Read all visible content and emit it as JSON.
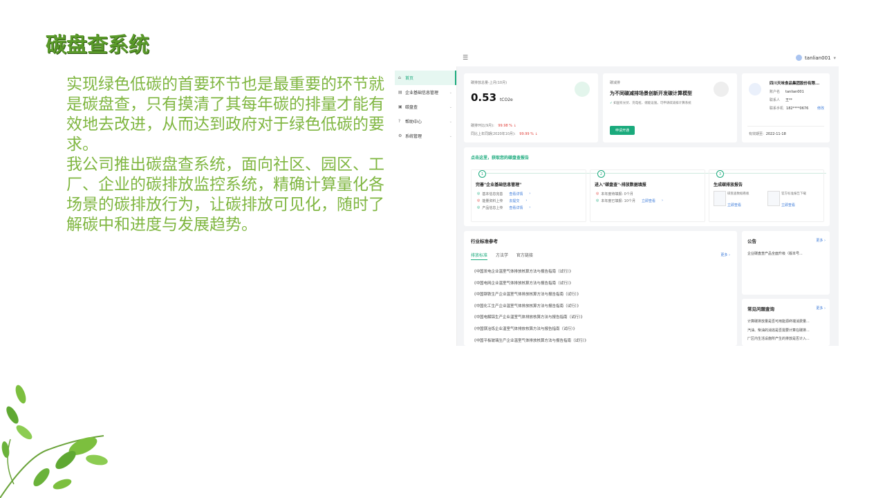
{
  "slide": {
    "title": "碳盘查系统",
    "paragraph1": "实现绿色低碳的首要环节也是最重要的环节就是碳盘查，只有摸清了其每年碳的排量才能有效地去改进，从而达到政府对于绿色低碳的要求。",
    "paragraph2": "我公司推出碳盘查系统，面向社区、园区、工厂、企业的碳排放监控系统，精确计算量化各场景的碳排放行为，让碳排放可见化，随时了解碳中和进度与发展趋势。"
  },
  "app": {
    "user": "tanlian001",
    "sidebar": [
      {
        "label": "首页",
        "icon": "home-icon"
      },
      {
        "label": "企业基础信息管理",
        "icon": "building-icon"
      },
      {
        "label": "碳盘查",
        "icon": "doc-icon"
      },
      {
        "label": "帮助中心",
        "icon": "help-icon"
      },
      {
        "label": "系统管理",
        "icon": "settings-icon"
      }
    ],
    "emission": {
      "label": "碳排放总量-上月(10月)",
      "value": "0.53",
      "unit": "tCO2e",
      "mom_label": "碳排环比(9月):",
      "mom_value": "99.98 %",
      "yoy_label": "同比上年同期(2020年10月):",
      "yoy_value": "99.99 %"
    },
    "reduction": {
      "label": "碳减排",
      "title": "为不同碳减排场景创新开发碳计算模型",
      "desc": "如固有光伏、充电桩、储能设施。可申请碳减排计算系统",
      "button": "申请开通"
    },
    "company": {
      "name": "四川天味食品集团股份有限...",
      "account_label": "账户名",
      "account": "tanlian001",
      "contact_label": "联系人",
      "contact": "王**",
      "phone_label": "联系手机",
      "phone": "182****0676",
      "edit": "修改",
      "expire_label": "有效期至:",
      "expire": "2022-11-18"
    },
    "report": {
      "title": "点击这里，获取您的碳盘查报告",
      "steps": [
        {
          "num": "1",
          "title": "完善\"企业基础信息管理\"",
          "rows": [
            {
              "status": "ok",
              "text": "基本信息完善",
              "link": "查看详情"
            },
            {
              "status": "warn",
              "text": "能量资料上传",
              "link": "去提交"
            },
            {
              "status": "ok",
              "text": "产品信息上传",
              "link": "查看详情"
            }
          ]
        },
        {
          "num": "2",
          "title": "进入\"碳盘查\"-排放数据填报",
          "rows": [
            {
              "status": "warn",
              "text": "本年度待填报: 0个月",
              "link": ""
            },
            {
              "status": "ok",
              "text": "本年度已填报: 10个月",
              "link": "立即查看"
            }
          ]
        },
        {
          "num": "3",
          "title": "生成碳排放报告",
          "docs": [
            {
              "text": "碳盘查数据看板",
              "link": "立即查看"
            },
            {
              "text": "官方标准报告下载",
              "link": "立即查看"
            }
          ]
        }
      ]
    },
    "standards": {
      "title": "行业标准参考",
      "tabs": [
        "排放标准",
        "方法学",
        "官方链接"
      ],
      "more": "更多",
      "items": [
        "《中国发电企业温室气体排放核算方法与报告指南（试行）》",
        "《中国电网企业温室气体排放核算方法与报告指南（试行）》",
        "《中国钢铁生产企业温室气体排放核算方法与报告指南（试行）》",
        "《中国化工生产企业温室气体排放核算方法与报告指南（试行）》",
        "《中国电解铝生产企业温室气体排放核算方法与报告指南（试行）》",
        "《中国镁冶炼企业温室气体排放核算方法与报告指南（试行）》",
        "《中国平板玻璃生产企业温室气体排放核算方法与报告指南（试行）》"
      ]
    },
    "notice": {
      "title": "公告",
      "more": "更多",
      "item": "企业碳盘查产品全面升级（版本号..."
    },
    "faq": {
      "title": "常见问题查询",
      "more": "更多",
      "items": [
        "计算碳排放量是否可用能源终端消费量...",
        "汽油、柴油的消逃是否需要计算在碳排...",
        "厂区内生活设施所产生的排放是否计入..."
      ]
    }
  }
}
